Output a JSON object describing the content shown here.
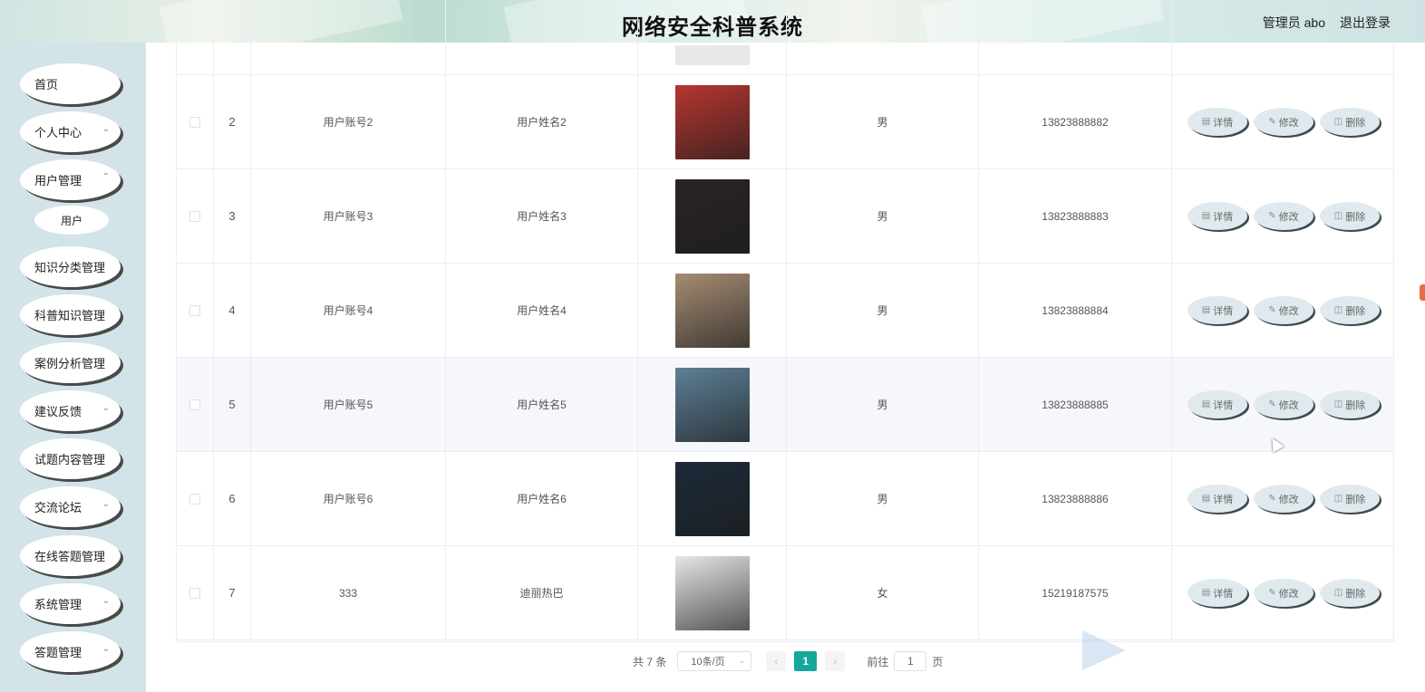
{
  "header": {
    "title": "网络安全科普系统",
    "admin": "管理员 abo",
    "logout": "退出登录"
  },
  "sidebar": {
    "items": [
      {
        "label": "首页",
        "has_children": false
      },
      {
        "label": "个人中心",
        "has_children": true
      },
      {
        "label": "用户管理",
        "has_children": true
      },
      {
        "label": "知识分类管理",
        "has_children": false
      },
      {
        "label": "科普知识管理",
        "has_children": false
      },
      {
        "label": "案例分析管理",
        "has_children": false
      },
      {
        "label": "建议反馈",
        "has_children": true
      },
      {
        "label": "试题内容管理",
        "has_children": false
      },
      {
        "label": "交流论坛",
        "has_children": true
      },
      {
        "label": "在线答题管理",
        "has_children": false
      },
      {
        "label": "系统管理",
        "has_children": true
      },
      {
        "label": "答题管理",
        "has_children": true
      }
    ],
    "subitem": "用户"
  },
  "table": {
    "rows": [
      {
        "index": "2",
        "account": "用户账号2",
        "name": "用户姓名2",
        "sex": "男",
        "phone": "13823888882",
        "photo_color": "#b5362f"
      },
      {
        "index": "3",
        "account": "用户账号3",
        "name": "用户姓名3",
        "sex": "男",
        "phone": "13823888883",
        "photo_color": "#2a2424"
      },
      {
        "index": "4",
        "account": "用户账号4",
        "name": "用户姓名4",
        "sex": "男",
        "phone": "13823888884",
        "photo_color": "#a58c73"
      },
      {
        "index": "5",
        "account": "用户账号5",
        "name": "用户姓名5",
        "sex": "男",
        "phone": "13823888885",
        "photo_color": "#5d7f96"
      },
      {
        "index": "6",
        "account": "用户账号6",
        "name": "用户姓名6",
        "sex": "男",
        "phone": "13823888886",
        "photo_color": "#1c2a38"
      },
      {
        "index": "7",
        "account": "333",
        "name": "迪丽热巴",
        "sex": "女",
        "phone": "15219187575",
        "photo_color": "#e6e6e6"
      }
    ],
    "highlight_row_index": "5",
    "ops": {
      "detail": "详情",
      "edit": "修改",
      "delete": "删除"
    }
  },
  "pagination": {
    "total": "共 7 条",
    "page_size": "10条/页",
    "current_page": "1",
    "goto_label": "前往",
    "goto_value": "1",
    "page_suffix": "页"
  },
  "colors": {
    "accent": "#14a89b",
    "sidebar_bg": "#d3e4e8"
  }
}
